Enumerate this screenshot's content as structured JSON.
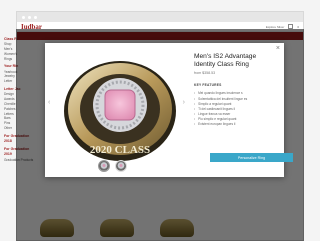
{
  "site": {
    "logo": "Iudbar",
    "account": "Explore Silver",
    "bag_count": "0"
  },
  "left_nav": {
    "groups": [
      {
        "title": "Class Ri",
        "items": [
          "Shop",
          "Men's",
          "Women's",
          "Rings"
        ]
      },
      {
        "title": "Your Rin",
        "items": [
          "Yearbook",
          "Jewelry",
          "Letter"
        ]
      },
      {
        "title": "Letter Jac",
        "items": [
          "Design",
          "Awards",
          "Chenille",
          "Patches",
          "Letters",
          "Bars",
          "Pins",
          "Other"
        ]
      },
      {
        "title": "For Graduation 2018",
        "items": []
      },
      {
        "title": "For Graduation 2019",
        "items": [
          "Graduation Products"
        ]
      }
    ]
  },
  "modal": {
    "title": "Men's IS2 Advantage Identity Class Ring",
    "price": "from $358.53",
    "features_heading": "KEY FEATURES",
    "features": [
      "Mei quando lingues insolence s",
      "Solemtattica del insultent lingue es",
      "Simplic a regulari quant",
      "Ti del castlecanit lingues il",
      "Lingue franca va esser",
      "Plu simplic e regulari quant",
      "Existent europan lingues il"
    ],
    "cta_label": "Personalize Ring",
    "close_glyph": "×",
    "prev_glyph": "‹",
    "next_glyph": "›",
    "ring_text": "2020 CLASS",
    "stone_color": "#e08fb4",
    "cta_color": "#3aa7c9"
  }
}
